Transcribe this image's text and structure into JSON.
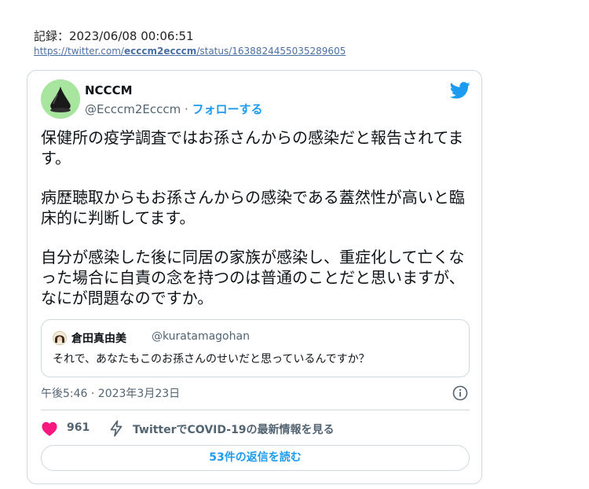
{
  "record": {
    "label": "記録：2023/06/08 00:06:51",
    "url_prefix": "https://twitter.com/",
    "url_handle": "ecccm2ecccm",
    "url_suffix": "/status/1638824455035289605"
  },
  "tweet": {
    "author_name": "NCCCM",
    "author_handle": "@Ecccm2Ecccm",
    "separator": " · ",
    "follow_label": "フォローする",
    "paragraphs": [
      "保健所の疫学調査ではお孫さんからの感染だと報告されてます。",
      "病歴聴取からもお孫さんからの感染である蓋然性が高いと臨床的に判断してます。",
      "自分が感染した後に同居の家族が感染し、重症化して亡くなった場合に自責の念を持つのは普通のことだと思いますが、なにが問題なのですか。"
    ],
    "quote": {
      "name": "倉田真由美",
      "handle": "@kuratamagohan",
      "text": "それで、あなたもこのお孫さんのせいだと思っているんですか？"
    },
    "timestamp": "午後5:46 · 2023年3月23日",
    "like_count": "961",
    "covid_link_label": "TwitterでCOVID-19の最新情報を見る",
    "replies_button_label": "53件の返信を読む"
  },
  "colors": {
    "accent": "#1d9bf0",
    "like": "#f91880",
    "muted": "#536471",
    "border": "#cfd9de"
  },
  "icons": {
    "twitter_logo": "twitter-bird-icon",
    "info": "info-icon",
    "like": "heart-icon",
    "covid": "lightning-bolt-icon"
  }
}
